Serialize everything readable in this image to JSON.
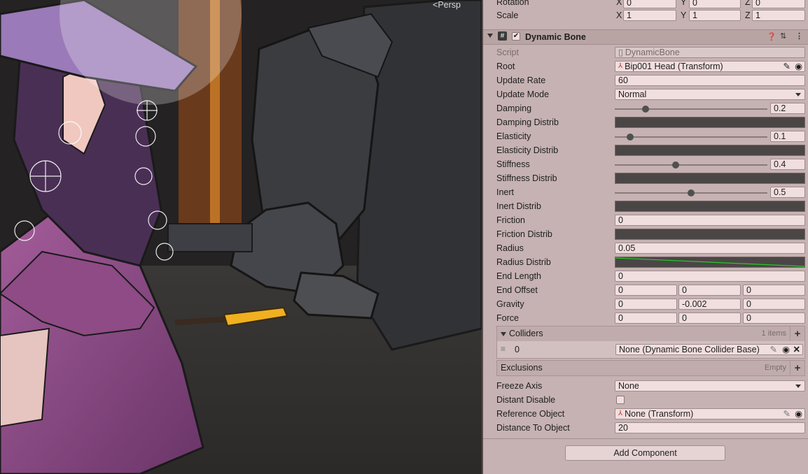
{
  "scene": {
    "view_label": "Persp"
  },
  "transform": {
    "rotation_label": "Rotation",
    "scale_label": "Scale",
    "axis": [
      "X",
      "Y",
      "Z"
    ],
    "rotation": [
      "0",
      "0",
      "0"
    ],
    "scale": [
      "1",
      "1",
      "1"
    ]
  },
  "component": {
    "title": "Dynamic Bone",
    "enabled": true,
    "icons": [
      "help-icon",
      "settings-sliders-icon",
      "kebab-menu-icon"
    ]
  },
  "fields": {
    "script": {
      "label": "Script",
      "value": "DynamicBone"
    },
    "root": {
      "label": "Root",
      "value": "Bip001 Head (Transform)"
    },
    "update_rate": {
      "label": "Update Rate",
      "value": "60"
    },
    "update_mode": {
      "label": "Update Mode",
      "value": "Normal"
    },
    "damping": {
      "label": "Damping",
      "value": "0.2",
      "fraction": 0.2
    },
    "damping_distrib": {
      "label": "Damping Distrib"
    },
    "elasticity": {
      "label": "Elasticity",
      "value": "0.1",
      "fraction": 0.1
    },
    "elasticity_distrib": {
      "label": "Elasticity Distrib"
    },
    "stiffness": {
      "label": "Stiffness",
      "value": "0.4",
      "fraction": 0.4
    },
    "stiffness_distrib": {
      "label": "Stiffness Distrib"
    },
    "inert": {
      "label": "Inert",
      "value": "0.5",
      "fraction": 0.5
    },
    "inert_distrib": {
      "label": "Inert Distrib"
    },
    "friction": {
      "label": "Friction",
      "value": "0"
    },
    "friction_distrib": {
      "label": "Friction Distrib"
    },
    "radius": {
      "label": "Radius",
      "value": "0.05"
    },
    "radius_distrib": {
      "label": "Radius Distrib",
      "curve_color": "#22cc22"
    },
    "end_length": {
      "label": "End Length",
      "value": "0"
    },
    "end_offset": {
      "label": "End Offset",
      "values": [
        "0",
        "0",
        "0"
      ]
    },
    "gravity": {
      "label": "Gravity",
      "values": [
        "0",
        "-0.002",
        "0"
      ]
    },
    "force": {
      "label": "Force",
      "values": [
        "0",
        "0",
        "0"
      ]
    },
    "freeze_axis": {
      "label": "Freeze Axis",
      "value": "None"
    },
    "distant_disable": {
      "label": "Distant Disable",
      "checked": false
    },
    "reference_object": {
      "label": "Reference Object",
      "value": "None (Transform)"
    },
    "distance_to_object": {
      "label": "Distance To Object",
      "value": "20"
    }
  },
  "colliders": {
    "title": "Colliders",
    "count": "1 items",
    "items": [
      {
        "index": "0",
        "value": "None (Dynamic Bone Collider Base)"
      }
    ]
  },
  "exclusions": {
    "title": "Exclusions",
    "count": "Empty"
  },
  "add_component": "Add Component",
  "colors": {
    "inspector_bg": "#c6b2b2",
    "field_bg": "#f1dede",
    "curve_bg": "#4b4646"
  }
}
